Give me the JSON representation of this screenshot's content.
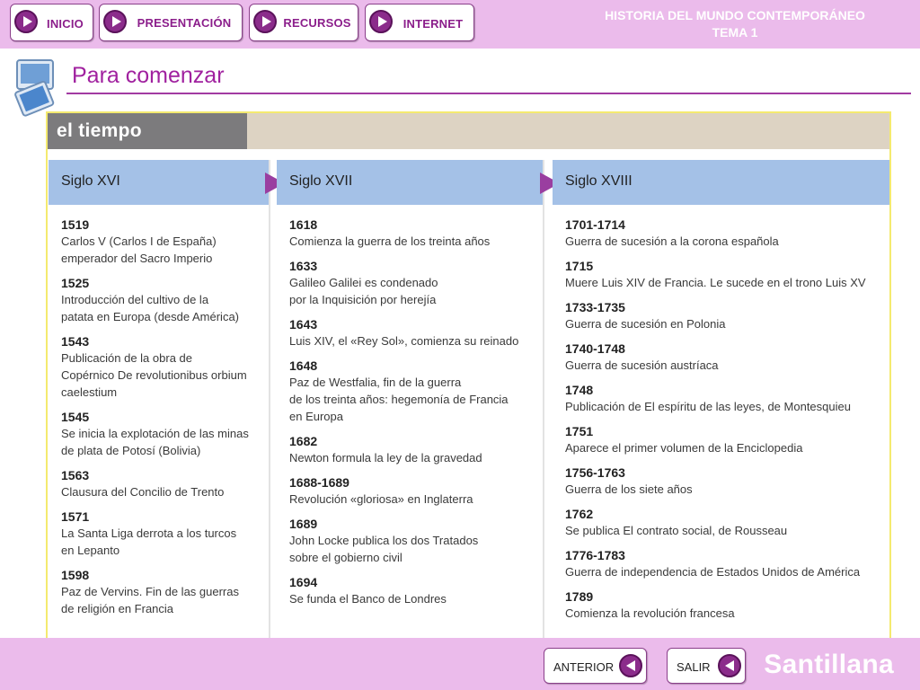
{
  "nav": {
    "inicio": "INICIO",
    "presentacion": "PRESENTACIÓN",
    "recursos": "RECURSOS",
    "internet": "INTERNET"
  },
  "header": {
    "line1": "HISTORIA DEL MUNDO CONTEMPORÁNEO",
    "line2": "TEMA 1"
  },
  "section_title": "Para comenzar",
  "panel_title": "el tiempo",
  "columns": [
    {
      "title": "Siglo XVI",
      "entries": [
        {
          "year": "1519",
          "text": [
            "Carlos V (Carlos I de España)",
            "emperador del Sacro Imperio"
          ]
        },
        {
          "year": "1525",
          "text": [
            "Introducción del cultivo de la",
            "patata en Europa (desde América)"
          ]
        },
        {
          "year": "1543",
          "text": [
            "Publicación de la obra de",
            "Copérnico De revolutionibus orbium",
            "caelestium"
          ]
        },
        {
          "year": "1545",
          "text": [
            "Se inicia la explotación de las minas",
            "de plata de Potosí (Bolivia)"
          ]
        },
        {
          "year": "1563",
          "text": [
            "Clausura del Concilio de Trento"
          ]
        },
        {
          "year": "1571",
          "text": [
            "La Santa Liga derrota a los turcos",
            "en Lepanto"
          ]
        },
        {
          "year": "1598",
          "text": [
            "Paz de Vervins. Fin de las guerras",
            "de religión en Francia"
          ]
        }
      ]
    },
    {
      "title": "Siglo XVII",
      "entries": [
        {
          "year": "1618",
          "text": [
            "Comienza la guerra de los treinta años"
          ]
        },
        {
          "year": "1633",
          "text": [
            "Galileo Galilei es condenado",
            "por la Inquisición por herejía"
          ]
        },
        {
          "year": "1643",
          "text": [
            "Luis XIV, el «Rey Sol», comienza su reinado"
          ]
        },
        {
          "year": "1648",
          "text": [
            "Paz de Westfalia, fin de la guerra",
            "de los treinta años: hegemonía de Francia",
            "en Europa"
          ]
        },
        {
          "year": "1682",
          "text": [
            "Newton formula la ley de la gravedad"
          ]
        },
        {
          "year": "1688-1689",
          "text": [
            "Revolución «gloriosa» en Inglaterra"
          ]
        },
        {
          "year": "1689",
          "text": [
            "John Locke publica los dos Tratados",
            "sobre el gobierno civil"
          ]
        },
        {
          "year": "1694",
          "text": [
            "Se funda el Banco de Londres"
          ]
        }
      ]
    },
    {
      "title": "Siglo XVIII",
      "entries": [
        {
          "year": "1701-1714",
          "text": [
            "Guerra de sucesión a la corona española"
          ]
        },
        {
          "year": "1715",
          "text": [
            "Muere Luis XIV de Francia. Le sucede en el trono Luis XV"
          ]
        },
        {
          "year": "1733-1735",
          "text": [
            "Guerra de sucesión en Polonia"
          ]
        },
        {
          "year": "1740-1748",
          "text": [
            "Guerra de sucesión austríaca"
          ]
        },
        {
          "year": "1748",
          "text": [
            "Publicación de El espíritu de las leyes, de Montesquieu"
          ]
        },
        {
          "year": "1751",
          "text": [
            "Aparece el primer volumen de la Enciclopedia"
          ]
        },
        {
          "year": "1756-1763",
          "text": [
            "Guerra de los siete años"
          ]
        },
        {
          "year": "1762",
          "text": [
            "Se publica El contrato social, de Rousseau"
          ]
        },
        {
          "year": "1776-1783",
          "text": [
            "Guerra de independencia de Estados Unidos de América"
          ]
        },
        {
          "year": "1789",
          "text": [
            "Comienza la revolución francesa"
          ]
        }
      ]
    }
  ],
  "footer": {
    "anterior": "ANTERIOR",
    "salir": "SALIR",
    "brand": "Santillana"
  },
  "colors": {
    "bar": "#ebbbeb",
    "accent": "#a0219f",
    "column_header": "#a4c1e7",
    "panel_border": "#f4ea6f"
  }
}
